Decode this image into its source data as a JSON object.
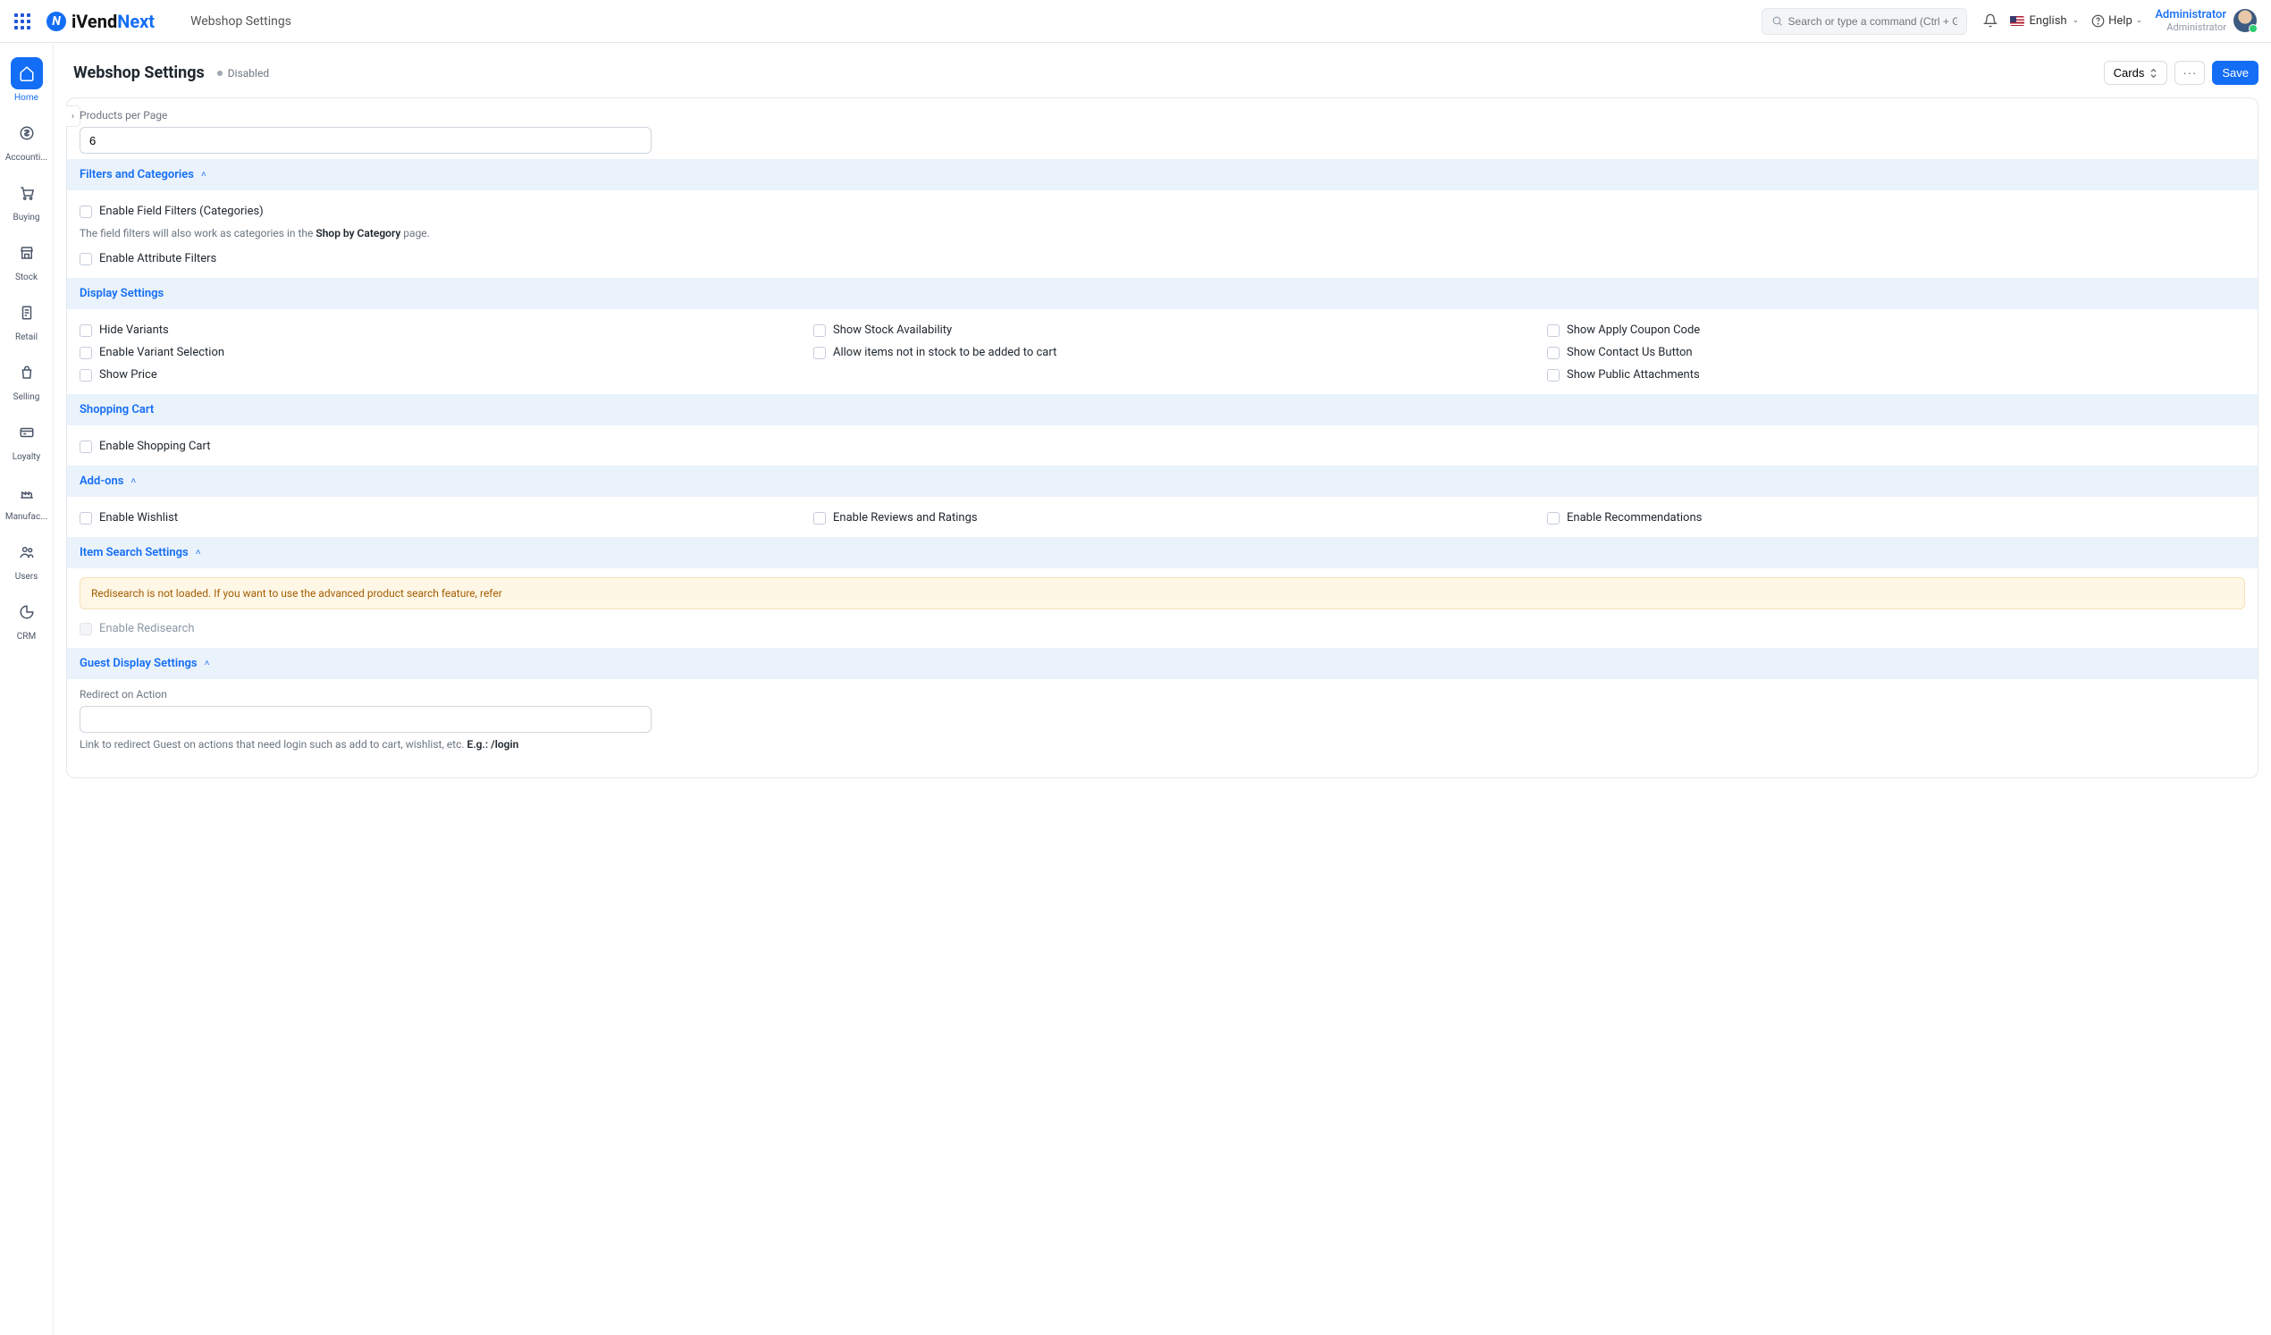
{
  "app": {
    "logo_ivend": "iVend",
    "logo_next": "Next",
    "breadcrumb": "Webshop Settings"
  },
  "search": {
    "placeholder": "Search or type a command (Ctrl + G)"
  },
  "topbar": {
    "language": "English",
    "help": "Help",
    "user_name": "Administrator",
    "user_role": "Administrator"
  },
  "sidebar": {
    "items": [
      {
        "label": "Home"
      },
      {
        "label": "Accounti..."
      },
      {
        "label": "Buying"
      },
      {
        "label": "Stock"
      },
      {
        "label": "Retail"
      },
      {
        "label": "Selling"
      },
      {
        "label": "Loyalty"
      },
      {
        "label": "Manufac..."
      },
      {
        "label": "Users"
      },
      {
        "label": "CRM"
      }
    ]
  },
  "page": {
    "title": "Webshop Settings",
    "status": "Disabled",
    "cards_btn": "Cards",
    "save_btn": "Save"
  },
  "fields": {
    "products_per_page_label": "Products per Page",
    "products_per_page_value": "6",
    "redirect_label": "Redirect on Action",
    "redirect_help_prefix": "Link to redirect Guest on actions that need login such as add to cart, wishlist, etc. ",
    "redirect_help_bold": "E.g.: /login"
  },
  "sections": {
    "filters": {
      "title": "Filters and Categories",
      "enable_field_filters": "Enable Field Filters (Categories)",
      "help_prefix": "The field filters will also work as categories in the ",
      "help_bold": "Shop by Category",
      "help_suffix": " page.",
      "enable_attribute_filters": "Enable Attribute Filters"
    },
    "display": {
      "title": "Display Settings",
      "hide_variants": "Hide Variants",
      "enable_variant_selection": "Enable Variant Selection",
      "show_price": "Show Price",
      "show_stock": "Show Stock Availability",
      "allow_oos": "Allow items not in stock to be added to cart",
      "show_coupon": "Show Apply Coupon Code",
      "show_contact": "Show Contact Us Button",
      "show_public_attachments": "Show Public Attachments"
    },
    "cart": {
      "title": "Shopping Cart",
      "enable_cart": "Enable Shopping Cart"
    },
    "addons": {
      "title": "Add-ons",
      "wishlist": "Enable Wishlist",
      "reviews": "Enable Reviews and Ratings",
      "recommendations": "Enable Recommendations"
    },
    "search": {
      "title": "Item Search Settings",
      "alert": "Redisearch is not loaded. If you want to use the advanced product search feature, refer",
      "enable_redisearch": "Enable Redisearch"
    },
    "guest": {
      "title": "Guest Display Settings"
    }
  }
}
